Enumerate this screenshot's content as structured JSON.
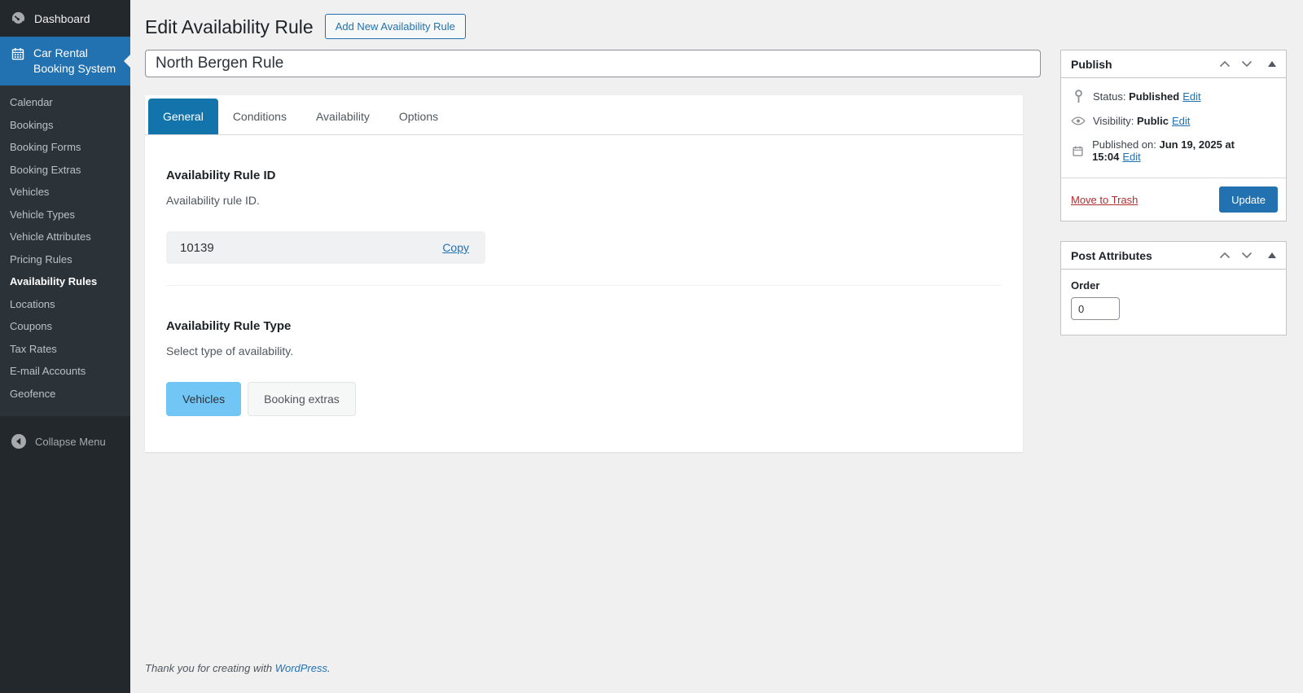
{
  "sidebar": {
    "dashboard_label": "Dashboard",
    "plugin_label": "Car Rental Booking System",
    "items": [
      "Calendar",
      "Bookings",
      "Booking Forms",
      "Booking Extras",
      "Vehicles",
      "Vehicle Types",
      "Vehicle Attributes",
      "Pricing Rules",
      "Availability Rules",
      "Locations",
      "Coupons",
      "Tax Rates",
      "E-mail Accounts",
      "Geofence"
    ],
    "active_item": "Availability Rules",
    "collapse_label": "Collapse Menu"
  },
  "header": {
    "page_title": "Edit Availability Rule",
    "add_new_button": "Add New Availability Rule",
    "title_value": "North Bergen Rule"
  },
  "tabs": [
    {
      "label": "General",
      "active": true
    },
    {
      "label": "Conditions",
      "active": false
    },
    {
      "label": "Availability",
      "active": false
    },
    {
      "label": "Options",
      "active": false
    }
  ],
  "sections": {
    "rule_id": {
      "heading": "Availability Rule ID",
      "description": "Availability rule ID.",
      "value": "10139",
      "copy_label": "Copy"
    },
    "rule_type": {
      "heading": "Availability Rule Type",
      "description": "Select type of availability.",
      "options": [
        {
          "label": "Vehicles",
          "selected": true
        },
        {
          "label": "Booking extras",
          "selected": false
        }
      ]
    }
  },
  "publish": {
    "title": "Publish",
    "status_label": "Status:",
    "status_value": "Published",
    "visibility_label": "Visibility:",
    "visibility_value": "Public",
    "published_label": "Published on:",
    "published_value": "Jun 19, 2025 at 15:04",
    "edit_label": "Edit",
    "move_to_trash": "Move to Trash",
    "update_label": "Update"
  },
  "post_attributes": {
    "title": "Post Attributes",
    "order_label": "Order",
    "order_value": "0"
  },
  "footer": {
    "prefix": "Thank you for creating with ",
    "link_label": "WordPress",
    "suffix": "."
  },
  "colors": {
    "accent": "#2271b1",
    "active_tab": "#1374ab",
    "selected_option": "#72c6f5",
    "danger_link": "#b32d2e",
    "sidebar_bg": "#23282d",
    "submenu_bg": "#2c3338",
    "page_bg": "#f0f0f1"
  }
}
